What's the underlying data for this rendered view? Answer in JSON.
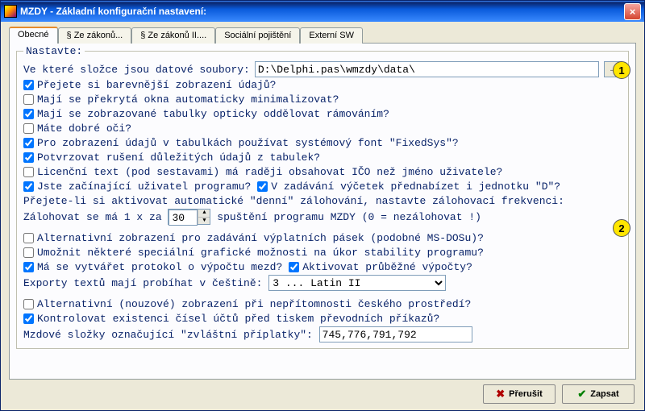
{
  "window": {
    "title": "MZDY - Základní konfigurační nastavení:"
  },
  "tabs": [
    {
      "label": "Obecné",
      "active": true
    },
    {
      "label": "§ Ze zákonů..."
    },
    {
      "label": "§ Ze zákonů II...."
    },
    {
      "label": "Sociální pojištění"
    },
    {
      "label": "Externí SW"
    }
  ],
  "group": {
    "legend": "Nastavte:"
  },
  "folder": {
    "label": "Ve které složce jsou datové soubory:",
    "value": "D:\\Delphi.pas\\wmzdy\\data\\"
  },
  "checks": {
    "c1": {
      "label": "Přejete si barevnější zobrazení údajů?",
      "checked": true
    },
    "c2": {
      "label": "Mají se překrytá okna automaticky minimalizovat?",
      "checked": false
    },
    "c3": {
      "label": "Mají se zobrazované tabulky opticky oddělovat rámováním?",
      "checked": true
    },
    "c4": {
      "label": "Máte dobré oči?",
      "checked": false
    },
    "c5": {
      "label": "Pro zobrazení údajů v tabulkách používat systémový font \"FixedSys\"?",
      "checked": true
    },
    "c6": {
      "label": "Potvrzovat rušení důležitých údajů z tabulek?",
      "checked": true
    },
    "c7": {
      "label": "Licenční text (pod sestavami) má raději obsahovat IČO než jméno uživatele?",
      "checked": false
    },
    "c8": {
      "label": "Jste začínající uživatel programu?",
      "checked": true
    },
    "c8b": {
      "label": "V zadávání výčetek přednabízet i jednotku \"D\"?",
      "checked": true
    },
    "c9": {
      "label": "Alternativní zobrazení pro zadávání výplatních pásek (podobné MS-DOSu)?",
      "checked": false
    },
    "c10": {
      "label": "Umožnit některé speciální grafické možnosti na úkor stability programu?",
      "checked": false
    },
    "c11": {
      "label": "Má se vytvářet protokol o výpočtu mezd?",
      "checked": true
    },
    "c11b": {
      "label": "Aktivovat průběžné výpočty?",
      "checked": true
    },
    "c12": {
      "label": "Alternativní (nouzové) zobrazení při nepřítomnosti českého prostředí?",
      "checked": false
    },
    "c13": {
      "label": "Kontrolovat existenci čísel účtů před tiskem převodních příkazů?",
      "checked": true
    }
  },
  "backup": {
    "intro": "Přejete-li si aktivovat automatické \"denní\" zálohování, nastavte zálohovací frekvenci:",
    "prefix": "Zálohovat se má 1 x za",
    "value": "30",
    "suffix": "spuštění programu MZDY (0 = nezálohovat !)"
  },
  "export": {
    "label": "Exporty textů mají probíhat v češtině:",
    "selected": "3 ... Latin II"
  },
  "special": {
    "label": "Mzdové složky označující \"zvláštní příplatky\":",
    "value": "745,776,791,792"
  },
  "markers": {
    "m1": "1",
    "m2": "2"
  },
  "buttons": {
    "cancel": "Přerušit",
    "save": "Zapsat"
  }
}
